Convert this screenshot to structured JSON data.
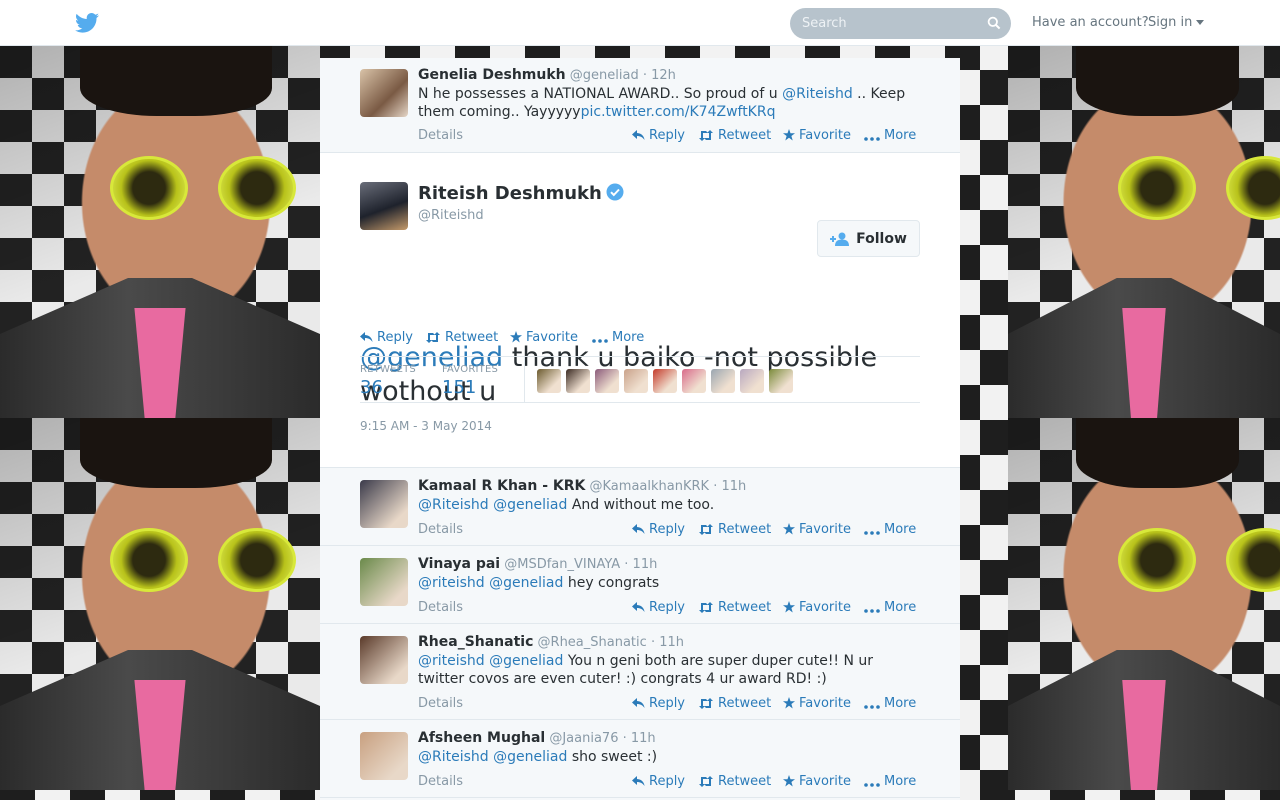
{
  "topbar": {
    "logo_icon": "twitter-bird-icon",
    "search_placeholder": "Search",
    "have_account": "Have an account?",
    "sign_in": "Sign in"
  },
  "context_tweet": {
    "name": "Genelia Deshmukh",
    "handle": "@geneliad",
    "time": "· 12h",
    "text_before": "N he possesses a NATIONAL AWARD.. So proud of u ",
    "mention": "@Riteishd",
    "text_after": " .. Keep them coming.. Yayyyyy",
    "link": "pic.twitter.com/K74ZwftKRq"
  },
  "actions": {
    "details": "Details",
    "reply": "Reply",
    "retweet": "Retweet",
    "favorite": "Favorite",
    "more": "More"
  },
  "focus_tweet": {
    "name": "Riteish Deshmukh",
    "handle": "@Riteishd",
    "follow_label": "Follow",
    "mention": "@geneliad",
    "text": " thank u baiko -not possible wothout u",
    "retweets_label": "RETWEETS",
    "retweets": "36",
    "favorites_label": "FAVORITES",
    "favorites": "151",
    "date": "9:15 AM - 3 May 2014",
    "favoriter_colors": [
      "#6b5a2e",
      "#3a2a22",
      "#8a5a7a",
      "#c9a28a",
      "#c43a2a",
      "#d86a8a",
      "#9aa6b0",
      "#b8a8c0",
      "#7a8a3a"
    ]
  },
  "replies": [
    {
      "name": "Kamaal R Khan - KRK",
      "handle": "@KamaalkhanKRK",
      "time": "· 11h",
      "mentions": "@Riteishd @geneliad",
      "text": "And without me too.",
      "avatar_color": "#3a3a4a"
    },
    {
      "name": "Vinaya pai",
      "handle": "@MSDfan_VINAYA",
      "time": "· 11h",
      "mentions": "@riteishd @geneliad",
      "text": "hey congrats",
      "avatar_color": "#6a8a4a"
    },
    {
      "name": "Rhea_Shanatic",
      "handle": "@Rhea_Shanatic",
      "time": "· 11h",
      "mentions": "@riteishd @geneliad",
      "text": "You n geni both are super duper cute!! N ur twitter covos are even cuter! :) congrats 4 ur award RD! :)",
      "avatar_color": "#5a3a2a"
    },
    {
      "name": "Afsheen Mughal",
      "handle": "@Jaania76",
      "time": "· 11h",
      "mentions": "@Riteishd @geneliad",
      "text": "sho sweet :)",
      "avatar_color": "#c8a080"
    }
  ],
  "colors": {
    "link": "#2b7bb9",
    "muted": "#8899a6",
    "text": "#292f33",
    "verified": "#55acee"
  }
}
